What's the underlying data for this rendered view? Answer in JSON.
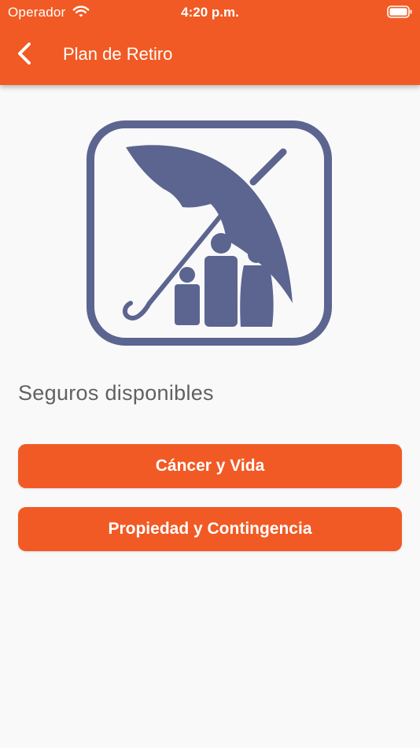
{
  "status_bar": {
    "carrier": "Operador",
    "time": "4:20 p.m.",
    "icons": [
      "wifi-icon",
      "battery-icon"
    ]
  },
  "nav": {
    "title": "Plan de Retiro",
    "back_icon": "chevron-left-icon"
  },
  "hero": {
    "icon": "umbrella-family-icon",
    "icon_color": "#5c6590"
  },
  "main": {
    "section_title": "Seguros disponibles",
    "buttons": [
      {
        "label": "Cáncer y Vida"
      },
      {
        "label": "Propiedad y Contingencia"
      }
    ]
  },
  "colors": {
    "accent": "#f15a24",
    "background": "#f9f9fa",
    "text_secondary": "#616161"
  }
}
